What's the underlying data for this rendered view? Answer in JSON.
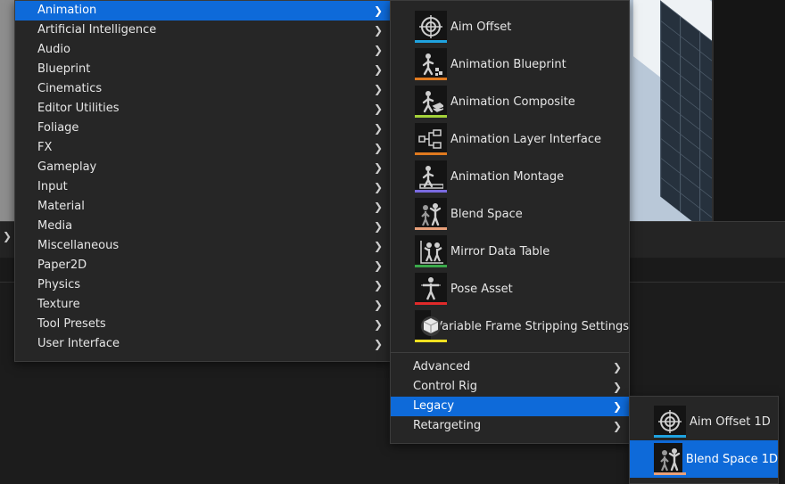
{
  "categories_menu": {
    "items": [
      {
        "label": "Animation",
        "selected": true
      },
      {
        "label": "Artificial Intelligence"
      },
      {
        "label": "Audio"
      },
      {
        "label": "Blueprint"
      },
      {
        "label": "Cinematics"
      },
      {
        "label": "Editor Utilities"
      },
      {
        "label": "Foliage"
      },
      {
        "label": "FX"
      },
      {
        "label": "Gameplay"
      },
      {
        "label": "Input"
      },
      {
        "label": "Material"
      },
      {
        "label": "Media"
      },
      {
        "label": "Miscellaneous"
      },
      {
        "label": "Paper2D"
      },
      {
        "label": "Physics"
      },
      {
        "label": "Texture"
      },
      {
        "label": "Tool Presets"
      },
      {
        "label": "User Interface"
      }
    ]
  },
  "animation_menu": {
    "assets": [
      {
        "label": "Aim Offset",
        "icon": "aim-offset-icon",
        "color": "#1fa3e0"
      },
      {
        "label": "Animation Blueprint",
        "icon": "animation-blueprint-icon",
        "color": "#e07a1f"
      },
      {
        "label": "Animation Composite",
        "icon": "animation-composite-icon",
        "color": "#a4d23a"
      },
      {
        "label": "Animation Layer Interface",
        "icon": "animation-layer-interface-icon",
        "color": "#e07a1f"
      },
      {
        "label": "Animation Montage",
        "icon": "animation-montage-icon",
        "color": "#7a6ae0"
      },
      {
        "label": "Blend Space",
        "icon": "blend-space-icon",
        "color": "#e8a07a"
      },
      {
        "label": "Mirror Data Table",
        "icon": "mirror-data-table-icon",
        "color": "#3aa84a"
      },
      {
        "label": "Pose Asset",
        "icon": "pose-asset-icon",
        "color": "#e02a2a"
      },
      {
        "label": "Variable Frame Stripping Settings",
        "icon": "variable-frame-stripping-icon",
        "color": "#f0e020"
      }
    ],
    "submenus": [
      {
        "label": "Advanced"
      },
      {
        "label": "Control Rig"
      },
      {
        "label": "Legacy",
        "selected": true
      },
      {
        "label": "Retargeting"
      }
    ]
  },
  "legacy_menu": {
    "assets": [
      {
        "label": "Aim Offset 1D",
        "icon": "aim-offset-1d-icon",
        "color": "#1fa3e0"
      },
      {
        "label": "Blend Space 1D",
        "icon": "blend-space-1d-icon",
        "color": "#e8a07a",
        "selected": true
      }
    ]
  },
  "colors": {
    "selection": "#0e6ad9",
    "menu_background": "#262626"
  }
}
